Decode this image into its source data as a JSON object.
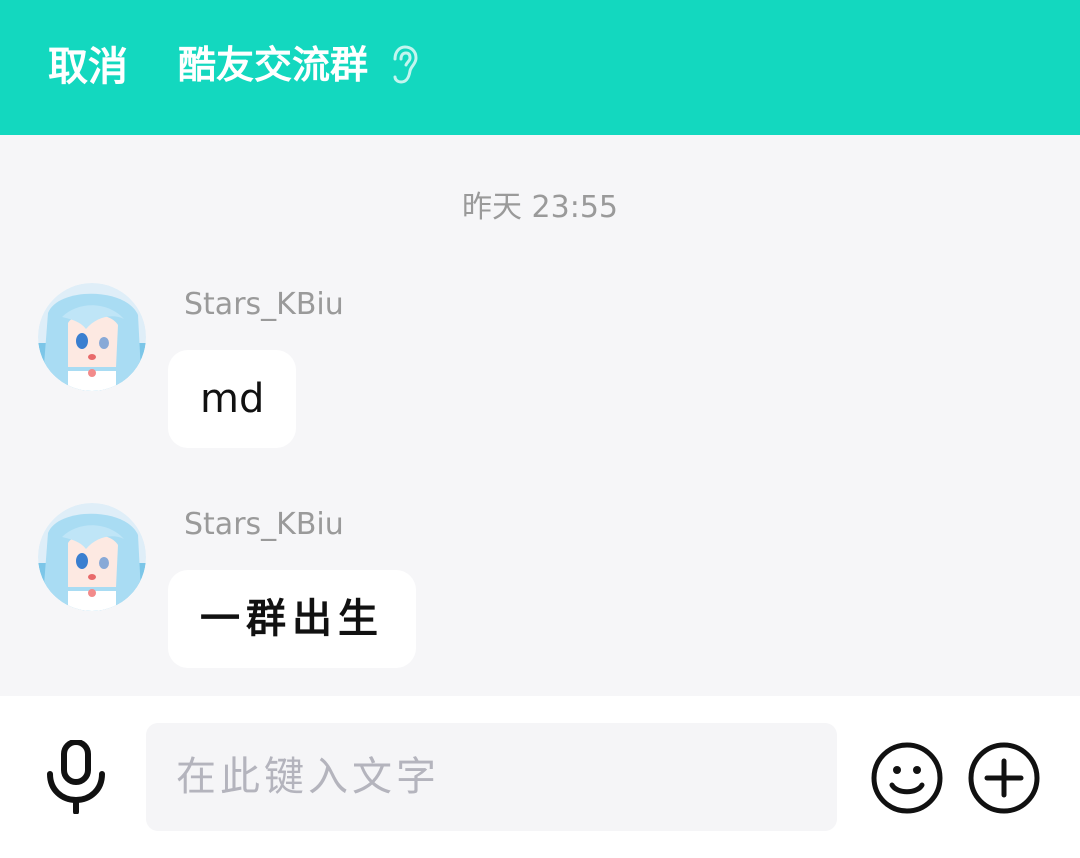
{
  "header": {
    "cancel_label": "取消",
    "title": "酷友交流群",
    "title_icon": "ear-icon",
    "background_color": "#13d8bf"
  },
  "chat": {
    "timestamp": "昨天 23:55",
    "messages": [
      {
        "sender": "Stars_KBiu",
        "text": "md"
      },
      {
        "sender": "Stars_KBiu",
        "text": "一群出生"
      }
    ]
  },
  "input_bar": {
    "voice_icon": "microphone-icon",
    "placeholder": "在此键入文字",
    "emoji_icon": "smiley-icon",
    "more_icon": "plus-circle-icon"
  }
}
